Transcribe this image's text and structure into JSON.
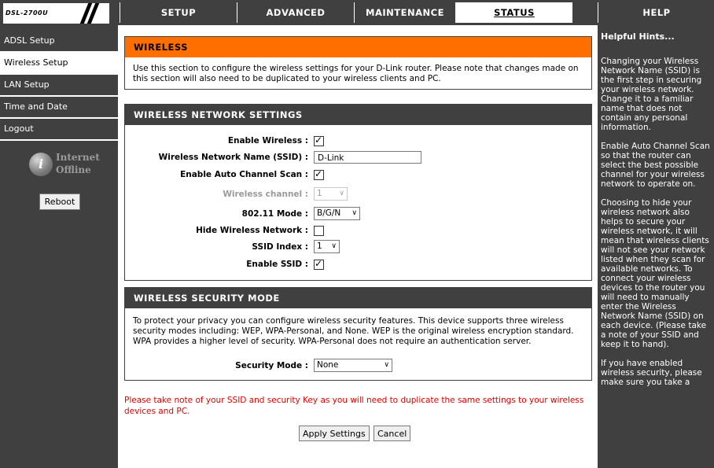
{
  "logo": {
    "model": "DSL-2700U"
  },
  "top_tabs": [
    {
      "label": "SETUP",
      "active": false
    },
    {
      "label": "ADVANCED",
      "active": false
    },
    {
      "label": "MAINTENANCE",
      "active": false
    },
    {
      "label": "STATUS",
      "active": true
    },
    {
      "label": "HELP",
      "active": false
    }
  ],
  "sidebar": {
    "items": [
      {
        "label": "ADSL Setup"
      },
      {
        "label": "Wireless Setup"
      },
      {
        "label": "LAN Setup"
      },
      {
        "label": "Time and Date"
      },
      {
        "label": "Logout"
      }
    ],
    "status_line1": "Internet",
    "status_line2": "Offline",
    "reboot_label": "Reboot"
  },
  "wireless": {
    "title": "WIRELESS",
    "description": "Use this section to configure the wireless settings for your D-Link router. Please note that changes made on this section will also need to be duplicated to your wireless clients and PC."
  },
  "network_settings": {
    "title": "WIRELESS NETWORK SETTINGS",
    "enable_wireless_label": "Enable Wireless :",
    "enable_wireless": true,
    "ssid_label": "Wireless Network Name (SSID) :",
    "ssid_value": "D-Link",
    "auto_channel_label": "Enable Auto Channel Scan :",
    "auto_channel": true,
    "channel_label": "Wireless channel :",
    "channel_value": "1",
    "mode_label": "802.11 Mode :",
    "mode_value": "B/G/N",
    "hide_label": "Hide Wireless Network :",
    "hide": false,
    "ssid_index_label": "SSID Index :",
    "ssid_index_value": "1",
    "enable_ssid_label": "Enable SSID :",
    "enable_ssid": true
  },
  "security": {
    "title": "WIRELESS SECURITY MODE",
    "description": "To protect your privacy you can configure wireless security features. This device supports three wireless security modes including: WEP, WPA-Personal, and None. WEP is the original wireless encryption standard. WPA provides a higher level of security. WPA-Personal does not require an authentication server.",
    "mode_label": "Security Mode :",
    "mode_value": "None"
  },
  "note": "Please take note of your SSID and security Key as you will need to duplicate the same settings to your wireless devices and PC.",
  "buttons": {
    "apply": "Apply Settings",
    "cancel": "Cancel"
  },
  "hints": {
    "title": "Helpful Hints...",
    "paragraphs": [
      "Changing your Wireless Network Name (SSID) is the first step in securing your wireless network. Change it to a familiar name that does not contain any personal information.",
      "Enable Auto Channel Scan so that the router can select the best possible channel for your wireless network to operate on.",
      "Choosing to hide your wireless network also helps to secure your wireless network, it will mean that wireless clients will not see your network listed when they scan for available networks. To connect your wireless devices to the router you will need to manually enter the Wireless Network Name (SSID) on each device. (Please take a note of your SSID and keep it to hand).",
      "If you have enabled wireless security, please make sure you take a"
    ]
  },
  "colors": {
    "dark": "#404040",
    "orange": "#ff6f00",
    "note_red": "#e00000"
  }
}
